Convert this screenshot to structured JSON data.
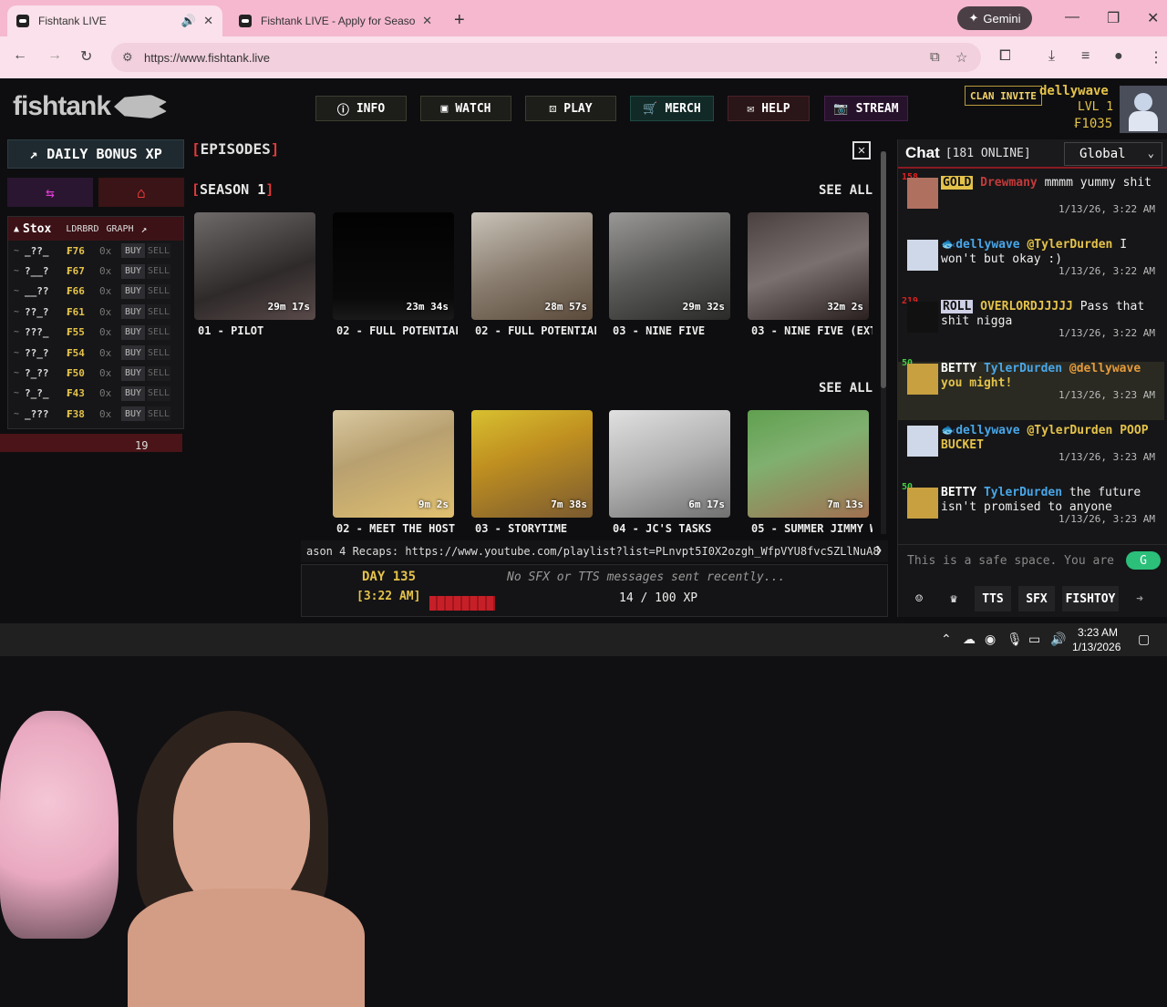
{
  "browser": {
    "tabs": [
      {
        "title": "Fishtank LIVE",
        "active": true
      },
      {
        "title": "Fishtank LIVE - Apply for Season",
        "active": false
      }
    ],
    "new_tab": "+",
    "gemini_label": "Gemini",
    "url": "https://www.fishtank.live"
  },
  "header": {
    "logo": "fishtank",
    "nav": [
      {
        "label": "INFO",
        "icon": "info-icon"
      },
      {
        "label": "WATCH",
        "icon": "camera-icon"
      },
      {
        "label": "PLAY",
        "icon": "dice-icon"
      },
      {
        "label": "MERCH",
        "icon": "cart-icon"
      },
      {
        "label": "HELP",
        "icon": "help-icon"
      },
      {
        "label": "STREAM",
        "icon": "stream-icon"
      }
    ],
    "clan_invite": "CLAN INVITE",
    "username": "dellywave",
    "level": "LVL 1",
    "coins": "₣1035"
  },
  "left_panel": {
    "daily_bonus": "DAILY BONUS XP",
    "stox": {
      "title": "Stox",
      "col1": "LDRBRD",
      "col2": "GRAPH",
      "rows": [
        {
          "name": "_??_",
          "price": "₣76",
          "owned": "0x",
          "buy": "BUY",
          "sell": "SELL"
        },
        {
          "name": "?__?",
          "price": "₣67",
          "owned": "0x",
          "buy": "BUY",
          "sell": "SELL"
        },
        {
          "name": "__??",
          "price": "₣66",
          "owned": "0x",
          "buy": "BUY",
          "sell": "SELL"
        },
        {
          "name": "??_?",
          "price": "₣61",
          "owned": "0x",
          "buy": "BUY",
          "sell": "SELL"
        },
        {
          "name": "???_",
          "price": "₣55",
          "owned": "0x",
          "buy": "BUY",
          "sell": "SELL"
        },
        {
          "name": "??_?",
          "price": "₣54",
          "owned": "0x",
          "buy": "BUY",
          "sell": "SELL"
        },
        {
          "name": "?_??",
          "price": "₣50",
          "owned": "0x",
          "buy": "BUY",
          "sell": "SELL"
        },
        {
          "name": "?_?_",
          "price": "₣43",
          "owned": "0x",
          "buy": "BUY",
          "sell": "SELL"
        },
        {
          "name": "_???",
          "price": "₣38",
          "owned": "0x",
          "buy": "BUY",
          "sell": "SELL"
        }
      ],
      "bottom_number": "19"
    }
  },
  "episodes": {
    "title": "EPISODES",
    "season_title": "SEASON 1",
    "see_all": "SEE ALL",
    "row1": [
      {
        "label": "01 - PILOT",
        "duration": "29m 17s"
      },
      {
        "label": "02 - FULL POTENTIAL",
        "duration": "23m 34s"
      },
      {
        "label": "02 - FULL POTENTIAL",
        "duration": "28m 57s"
      },
      {
        "label": "03 - NINE FIVE",
        "duration": "29m 32s"
      },
      {
        "label": "03 - NINE FIVE (EXT",
        "duration": "32m 2s"
      }
    ],
    "row2": [
      {
        "label": "02 - MEET THE HOST",
        "duration": "9m 2s"
      },
      {
        "label": "03 - STORYTIME",
        "duration": "7m 38s"
      },
      {
        "label": "04 - JC'S TASKS",
        "duration": "6m 17s"
      },
      {
        "label": "05 - SUMMER JIMMY W",
        "duration": "7m 13s"
      }
    ],
    "recaps": "ason 4 Recaps: https://www.youtube.com/playlist?list=PLnvpt5I0X2ozgh_WfpVYU8fvcSZLlNuA8"
  },
  "status": {
    "day": "DAY 135",
    "time": "[3:22 AM]",
    "sfx": "No SFX or TTS messages sent recently...",
    "xp": "14 / 100 XP",
    "xp_fraction": 0.14
  },
  "chat": {
    "title": "Chat",
    "online": "[181 ONLINE]",
    "room": "Global",
    "messages": [
      {
        "level": "158",
        "badge": "GOLD",
        "user": "Drewmany",
        "text": "mmmm yummy shit",
        "ts": "1/13/26, 3:22 AM"
      },
      {
        "level": "",
        "badge": "",
        "user": "dellywave",
        "mention": "@TylerDurden",
        "text": "I won't but okay :)",
        "ts": "1/13/26, 3:22 AM"
      },
      {
        "level": "219",
        "badge": "ROLL",
        "user": "OVERLORDJJJJJ",
        "text": "Pass that shit nigga",
        "ts": "1/13/26, 3:22 AM"
      },
      {
        "level": "50",
        "badge": "BETTY",
        "user": "TylerDurden",
        "mention": "@dellywave",
        "text": "you might!",
        "ts": "1/13/26, 3:23 AM"
      },
      {
        "level": "",
        "badge": "",
        "user": "dellywave",
        "mention": "@TylerDurden",
        "text": "POOP BUCKET",
        "ts": "1/13/26, 3:23 AM"
      },
      {
        "level": "50",
        "badge": "BETTY",
        "user": "TylerDurden",
        "text": "the future isn't promised to anyone",
        "ts": "1/13/26, 3:23 AM"
      }
    ],
    "input_placeholder": "This is a safe space. You are",
    "toolbar": {
      "tts": "TTS",
      "sfx": "SFX",
      "fishtoy": "FISHTOY"
    }
  },
  "taskbar": {
    "time": "3:23 AM",
    "date": "1/13/2026"
  },
  "colors": {
    "accent_red": "#e23a3a",
    "gold": "#e4c24a",
    "chat_blue": "#48a6e8"
  }
}
